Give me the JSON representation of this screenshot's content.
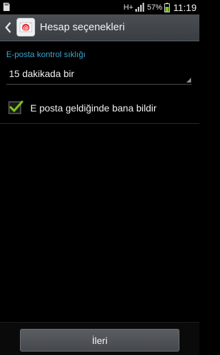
{
  "status_bar": {
    "network": "H+",
    "battery_percent": "57%",
    "time": "11:19"
  },
  "action_bar": {
    "title": "Hesap seçenekleri",
    "back_icon": "chevron-left-icon",
    "app_icon": "email-app-icon"
  },
  "content": {
    "check_frequency_label": "E-posta kontrol sıklığı",
    "check_frequency_value": "15 dakikada bir",
    "notify_checkbox_label": "E posta geldiğinde bana bildir",
    "notify_checked": true
  },
  "footer": {
    "next_label": "İleri"
  },
  "colors": {
    "accent": "#3aa6d0",
    "check": "#7cc41e",
    "battery": "#7cc41e"
  }
}
